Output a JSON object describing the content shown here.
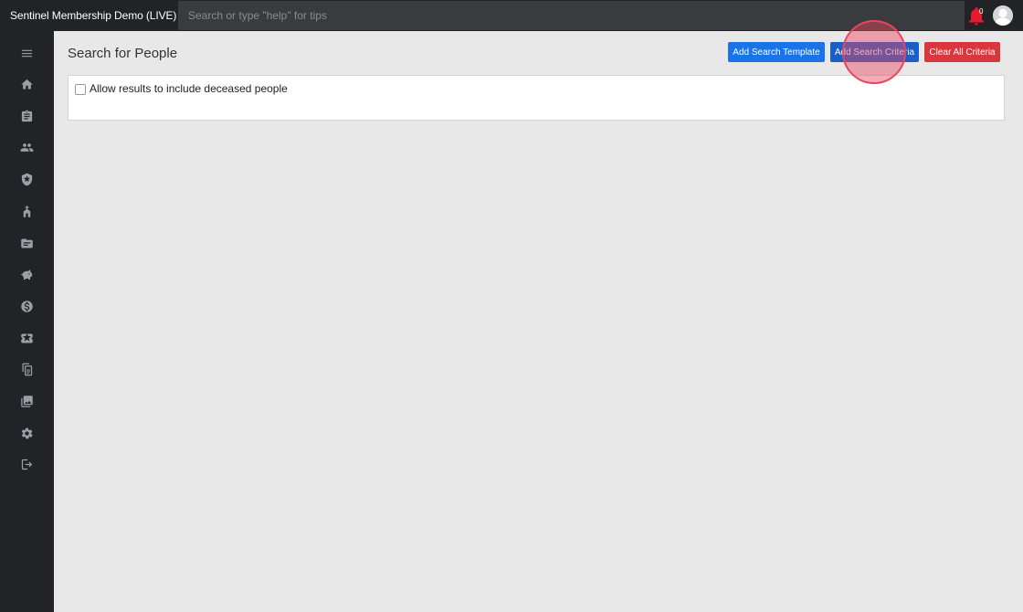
{
  "header": {
    "app_title": "Sentinel Membership Demo (LIVE)",
    "search_placeholder": "Search or type \"help\" for tips",
    "notification_count": "0"
  },
  "sidebar": {
    "items": [
      {
        "icon": "hamburger-menu-icon"
      },
      {
        "icon": "home-icon"
      },
      {
        "icon": "clipboard-icon"
      },
      {
        "icon": "people-icon"
      },
      {
        "icon": "shield-icon"
      },
      {
        "icon": "church-icon"
      },
      {
        "icon": "folder-icon"
      },
      {
        "icon": "piggy-bank-icon"
      },
      {
        "icon": "dollar-icon"
      },
      {
        "icon": "ticket-icon"
      },
      {
        "icon": "document-copy-icon"
      },
      {
        "icon": "photo-library-icon"
      },
      {
        "icon": "gear-icon"
      },
      {
        "icon": "logout-icon"
      }
    ]
  },
  "main": {
    "page_title": "Search for People",
    "buttons": {
      "add_template": "Add Search Template",
      "add_criteria": "Add Search Criteria",
      "clear_all": "Clear All Criteria"
    },
    "deceased_checkbox": {
      "label": "Allow results to include deceased people",
      "checked": false
    }
  },
  "colors": {
    "topbar": "#222327",
    "background": "#e8e8e8",
    "primary_button": "#1a73e8",
    "danger_button": "#d9363e",
    "notification": "#e8192c"
  }
}
